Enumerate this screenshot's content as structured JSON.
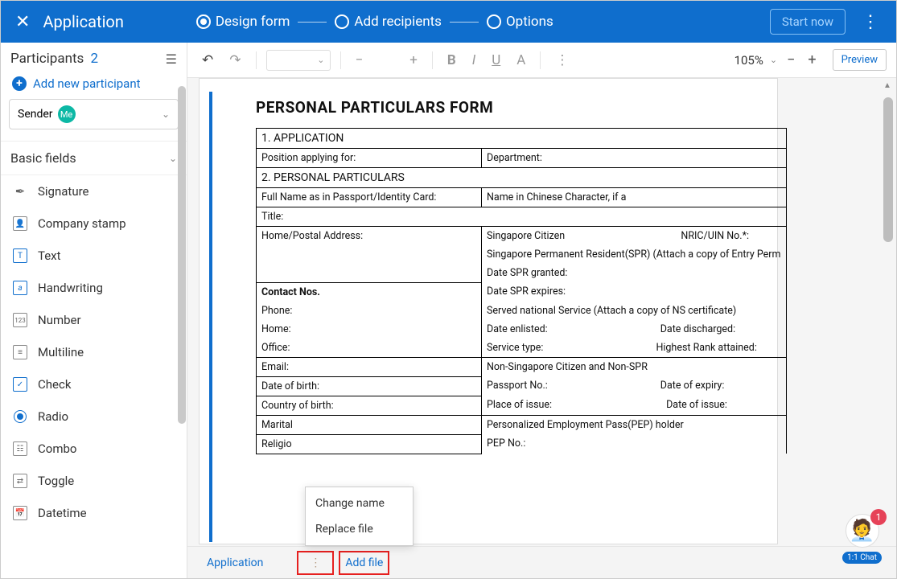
{
  "header": {
    "title": "Application",
    "steps": [
      "Design form",
      "Add recipients",
      "Options"
    ],
    "active_step": 0,
    "start_label": "Start now"
  },
  "sidebar": {
    "participants_label": "Participants",
    "participants_count": "2",
    "add_participant": "Add new participant",
    "sender_label": "Sender",
    "sender_chip": "Me",
    "basic_fields_label": "Basic fields",
    "fields": [
      {
        "icon": "signature",
        "label": "Signature"
      },
      {
        "icon": "stamp",
        "label": "Company stamp"
      },
      {
        "icon": "text",
        "label": "Text"
      },
      {
        "icon": "handwriting",
        "label": "Handwriting"
      },
      {
        "icon": "number",
        "label": "Number"
      },
      {
        "icon": "multiline",
        "label": "Multiline"
      },
      {
        "icon": "check",
        "label": "Check"
      },
      {
        "icon": "radio",
        "label": "Radio"
      },
      {
        "icon": "combo",
        "label": "Combo"
      },
      {
        "icon": "toggle",
        "label": "Toggle"
      },
      {
        "icon": "datetime",
        "label": "Datetime"
      }
    ]
  },
  "toolbar": {
    "zoom": "105%",
    "preview": "Preview"
  },
  "document": {
    "title": "PERSONAL PARTICULARS FORM",
    "s1": "1. APPLICATION",
    "pos": "Position applying for:",
    "dept": "Department:",
    "s2": "2. PERSONAL PARTICULARS",
    "fullname": "Full Name as in Passport/Identity Card:",
    "chinese": "Name in Chinese Character, if a",
    "title_lbl": "Title:",
    "addr": "Home/Postal Address:",
    "sg_cit": "Singapore Citizen",
    "nric": "NRIC/UIN No.*:",
    "spr": "Singapore Permanent Resident(SPR) (Attach a copy of Entry Perm",
    "spr_grant": "Date SPR granted:",
    "spr_exp": "Date SPR expires:",
    "contact": "Contact Nos.",
    "phone": "Phone:",
    "home": "Home:",
    "office": "Office:",
    "served": "Served national Service (Attach a copy of NS certificate)",
    "enlisted": "Date enlisted:",
    "discharged": "Date discharged:",
    "svc_type": "Service type:",
    "rank": "Highest Rank attained:",
    "email": "Email:",
    "non_sg": "Non-Singapore Citizen and Non-SPR",
    "dob": "Date of birth:",
    "passport": "Passport No.:",
    "doe": "Date of expiry:",
    "cob": "Country of birth:",
    "poi": "Place of issue:",
    "doi": "Date of issue:",
    "marital": "Marital",
    "pep": "Personalized Employment Pass(PEP) holder",
    "pepno": "PEP No.:",
    "religio": "Religio"
  },
  "ctx": {
    "change": "Change name",
    "replace": "Replace file"
  },
  "bottom": {
    "tab_app": "Application",
    "add_file": "Add file"
  },
  "chat": {
    "badge": "1",
    "label": "1:1 Chat"
  }
}
